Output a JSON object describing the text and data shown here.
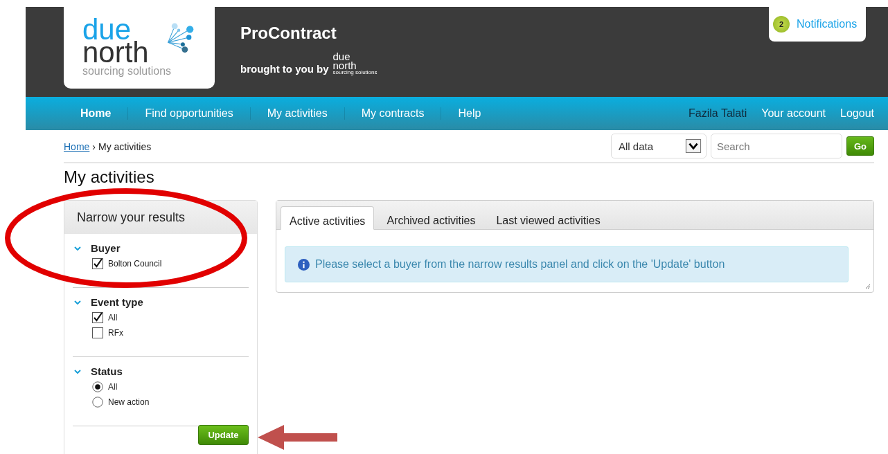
{
  "logo": {
    "lines": [
      "due",
      "north",
      "sourcing solutions"
    ]
  },
  "site_title": "ProContract",
  "tagline": "brought to you by",
  "small_logo": {
    "lines": [
      "due",
      "north",
      "sourcing solutions"
    ]
  },
  "notifications": {
    "count": "2",
    "label": "Notifications"
  },
  "nav": [
    {
      "label": "Home",
      "selected": true
    },
    {
      "label": "Find opportunities",
      "selected": false
    },
    {
      "label": "My activities",
      "selected": false
    },
    {
      "label": "My contracts",
      "selected": false
    },
    {
      "label": "Help",
      "selected": false
    }
  ],
  "user": {
    "name": "Fazila Talati",
    "links": [
      "Your account",
      "Logout"
    ]
  },
  "breadcrumb": {
    "link": "Home",
    "separator": "›",
    "current": "My activities"
  },
  "search": {
    "scope": "All data",
    "placeholder": "Search",
    "button": "Go"
  },
  "page_title": "My activities",
  "filter_panel": {
    "title": "Narrow your results",
    "groups": [
      {
        "title": "Buyer",
        "kind": "checkbox",
        "options": [
          {
            "label": "Bolton Council",
            "checked": true
          }
        ]
      },
      {
        "title": "Event type",
        "kind": "checkbox",
        "options": [
          {
            "label": "All",
            "checked": true
          },
          {
            "label": "RFx",
            "checked": false
          }
        ]
      },
      {
        "title": "Status",
        "kind": "radio",
        "options": [
          {
            "label": "All",
            "checked": true
          },
          {
            "label": "New action",
            "checked": false
          }
        ]
      }
    ],
    "button": "Update"
  },
  "tabs": [
    {
      "label": "Active activities",
      "selected": true
    },
    {
      "label": "Archived activities",
      "selected": false
    },
    {
      "label": "Last viewed activities",
      "selected": false
    }
  ],
  "info_message": "Please select a buyer from the narrow results panel and click on the 'Update' button"
}
